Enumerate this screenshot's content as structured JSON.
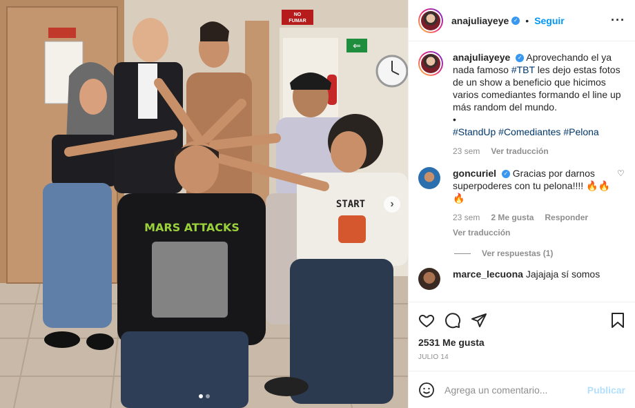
{
  "header": {
    "username": "anajuliayeye",
    "separator": "•",
    "follow_label": "Seguir",
    "more_icon": "more-horizontal-icon",
    "verified_icon": "verified-badge-icon"
  },
  "photo": {
    "sign_no_fumar": "NO FUMAR",
    "sign_exit": "⇐",
    "shirt_text": "MARS ATTACKS",
    "shirt_text_2": "START",
    "carousel_index": 1,
    "carousel_total": 2
  },
  "caption": {
    "username": "anajuliayeye",
    "text_1": "Aprovechando el ya nada famoso ",
    "tag_tbt": "#TBT",
    "text_2": " les dejo estas fotos de un show a beneficio que hicimos varios comediantes formando el line up más random del mundo.",
    "bullet": "•",
    "hashtags": "#StandUp #Comediantes #Pelona",
    "time": "23 sem",
    "translate": "Ver traducción"
  },
  "comments": [
    {
      "username": "goncuriel",
      "text": "Gracias por darnos superpoderes con tu pelona!!!! 🔥🔥🔥",
      "time": "23 sem",
      "likes": "2 Me gusta",
      "reply": "Responder",
      "translate": "Ver traducción",
      "view_replies": "Ver respuestas (1)"
    },
    {
      "username": "marce_lecuona",
      "text": "Jajajaja sí somos"
    }
  ],
  "stats": {
    "likes": "2531 Me gusta",
    "date": "JULIO 14"
  },
  "compose": {
    "placeholder": "Agrega un comentario...",
    "publish_label": "Publicar"
  }
}
